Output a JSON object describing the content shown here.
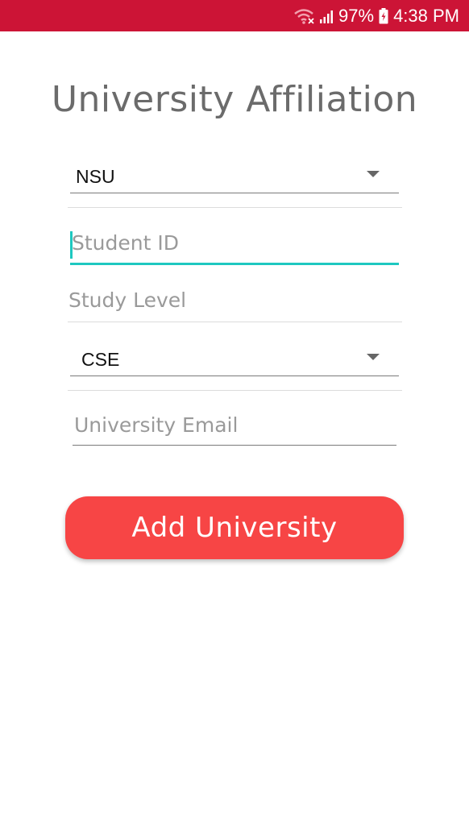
{
  "status_bar": {
    "battery": "97%",
    "time": "4:38 PM",
    "icons": [
      "wifi-icon",
      "signal-icon",
      "battery-charging-icon"
    ],
    "background_color": "#cc1436"
  },
  "page": {
    "title": "University Affiliation"
  },
  "form": {
    "university_spinner": {
      "selected": "NSU"
    },
    "student_id": {
      "placeholder": "Student ID",
      "value": ""
    },
    "study_level": {
      "label": "Study Level"
    },
    "department_spinner": {
      "selected": "CSE"
    },
    "university_email": {
      "placeholder": "University Email",
      "value": ""
    },
    "submit_label": "Add University"
  },
  "colors": {
    "accent_teal": "#1ec8c0",
    "button_red": "#f74545",
    "title_gray": "#6b6b6b",
    "hint_gray": "#9a9a9a"
  }
}
